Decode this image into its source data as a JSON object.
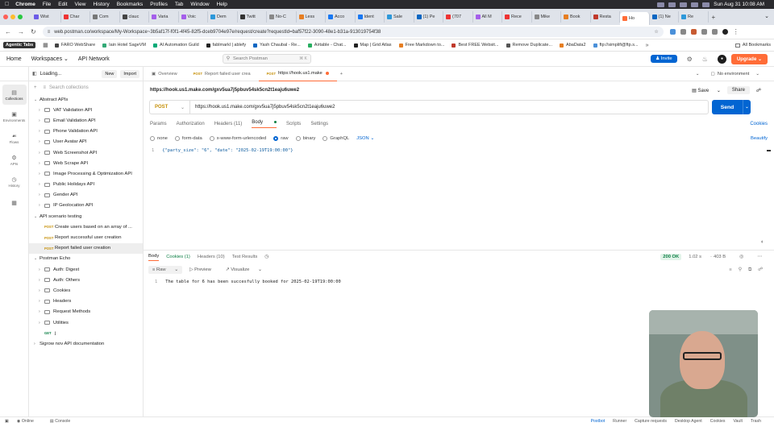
{
  "menubar": {
    "items": [
      "Chrome",
      "File",
      "Edit",
      "View",
      "History",
      "Bookmarks",
      "Profiles",
      "Tab",
      "Window",
      "Help"
    ],
    "datetime": "Sun Aug 31  10:08 AM"
  },
  "browser_tabs": [
    "Wist",
    "Char",
    "Com",
    "clauc",
    "Varia",
    "Voic",
    "Dem",
    "Twitt",
    "No-C",
    "Less",
    "Acco",
    "Ident",
    "Sale",
    "(1) Pe",
    "(707",
    "All M",
    "Rece",
    "Mike",
    "Book",
    "Resta",
    "Ho",
    "(1) Ne",
    "Re"
  ],
  "address": {
    "url": "web.postman.co/workspace/My-Workspace~3b5af17f-f0f1-4f45-82f5-dceb9704e97e/request/create?requestId=baf57f22-3090-48e1-b31a-913019754f38"
  },
  "bookmarks": [
    "Agentic Tabs",
    "FARO WebShare",
    "Iain Hotel SageVM",
    "AI Automation Guild",
    "fablmarkl | ablefy",
    "Yash Chaubal - Re...",
    "Airtable - Chat...",
    "Map | Grid Atlas",
    "Free Markdown to...",
    "Best FREE Websit...",
    "Remove Duplicate...",
    "AbaData2",
    "ftp://simplifi@ftp.s..."
  ],
  "bookmarks_all": "All Bookmarks",
  "postman": {
    "nav": [
      "Home",
      "Workspaces",
      "API Network"
    ],
    "search_placeholder": "Search Postman",
    "search_kbd": "⌘ K",
    "invite": "Invite",
    "upgrade": "Upgrade"
  },
  "rail": [
    "Collections",
    "Environments",
    "Flows",
    "APIs",
    "History"
  ],
  "sidebar": {
    "status": "Loading...",
    "new": "New",
    "import": "Import",
    "search_placeholder": "Search collections",
    "tree": [
      {
        "label": "Abstract APIs",
        "level": 0,
        "kind": "collection",
        "open": true
      },
      {
        "label": "VAT Validation API",
        "level": 1,
        "kind": "folder"
      },
      {
        "label": "Email Validation API",
        "level": 1,
        "kind": "folder"
      },
      {
        "label": "Phone Validation API",
        "level": 1,
        "kind": "folder"
      },
      {
        "label": "User Avatar API",
        "level": 1,
        "kind": "folder"
      },
      {
        "label": "Web Screenshot API",
        "level": 1,
        "kind": "folder"
      },
      {
        "label": "Web Scrape API",
        "level": 1,
        "kind": "folder"
      },
      {
        "label": "Image Processing & Optimization API",
        "level": 1,
        "kind": "folder"
      },
      {
        "label": "Public Holidays API",
        "level": 1,
        "kind": "folder"
      },
      {
        "label": "Gender API",
        "level": 1,
        "kind": "folder"
      },
      {
        "label": "IP Geolocation API",
        "level": 1,
        "kind": "folder"
      },
      {
        "label": "API scenario testing",
        "level": 0,
        "kind": "collection",
        "open": true
      },
      {
        "label": "Create users based on an array of ...",
        "level": 1,
        "kind": "request",
        "method": "POST"
      },
      {
        "label": "Report successful user creation",
        "level": 1,
        "kind": "request",
        "method": "POST"
      },
      {
        "label": "Report failed user creation",
        "level": 1,
        "kind": "request",
        "method": "POST",
        "selected": true
      },
      {
        "label": "Postman Echo",
        "level": 0,
        "kind": "collection",
        "open": true
      },
      {
        "label": "Auth: Digest",
        "level": 1,
        "kind": "folder"
      },
      {
        "label": "Auth: Others",
        "level": 1,
        "kind": "folder"
      },
      {
        "label": "Cookies",
        "level": 1,
        "kind": "folder"
      },
      {
        "label": "Headers",
        "level": 1,
        "kind": "folder"
      },
      {
        "label": "Request Methods",
        "level": 1,
        "kind": "folder"
      },
      {
        "label": "Utilities",
        "level": 1,
        "kind": "folder"
      },
      {
        "label": "j",
        "level": 1,
        "kind": "request",
        "method": "GET"
      },
      {
        "label": "Sigrow nov API documentation",
        "level": 0,
        "kind": "collection",
        "open": false
      }
    ]
  },
  "request_tabs": {
    "overview": "Overview",
    "tab1_method": "POST",
    "tab1_label": "Report failed user crea",
    "tab2_method": "POST",
    "tab2_label": "https://hook.us1.make",
    "new_tab": "+",
    "environment": "No environment"
  },
  "request": {
    "title": "https://hook.us1.make.com/gxv5ua7j5pbuv54sk5cn2t1eaju6uwe2",
    "save": "Save",
    "share": "Share",
    "method": "POST",
    "url": "https://hook.us1.make.com/gxv5ua7j5pbuv54sk5cn2t1eaju6uwe2",
    "send": "Send",
    "option_tabs": [
      "Params",
      "Authorization",
      "Headers (11)",
      "Body",
      "Scripts",
      "Settings"
    ],
    "cookies": "Cookies",
    "body_types": [
      "none",
      "form-data",
      "x-www-form-urlencoded",
      "raw",
      "binary",
      "GraphQL"
    ],
    "body_format": "JSON",
    "beautify": "Beautify",
    "body_line_no": "1",
    "body_code": "{\"party_size\": \"6\", \"date\": \"2025-02-19T19:00:00\"}"
  },
  "response": {
    "tabs": [
      "Body",
      "Cookies (1)",
      "Headers (10)",
      "Test Results"
    ],
    "status": "200 OK",
    "time": "1.02 s",
    "size": "403 B",
    "view": "Raw",
    "preview": "Preview",
    "visualize": "Visualize",
    "line_no": "1",
    "text": "The table for 6 has been succesfully booked for 2025-02-19T19:00:00"
  },
  "footer": {
    "left": [
      "Online",
      "Console"
    ],
    "right": [
      "Postbot",
      "Runner",
      "Capture requests",
      "Desktop Agent",
      "Cookies",
      "Vault",
      "Trash"
    ]
  },
  "colors": {
    "accent": "#ff6c37",
    "primary": "#0265d2",
    "post": "#c69009",
    "get": "#0a7e43"
  }
}
